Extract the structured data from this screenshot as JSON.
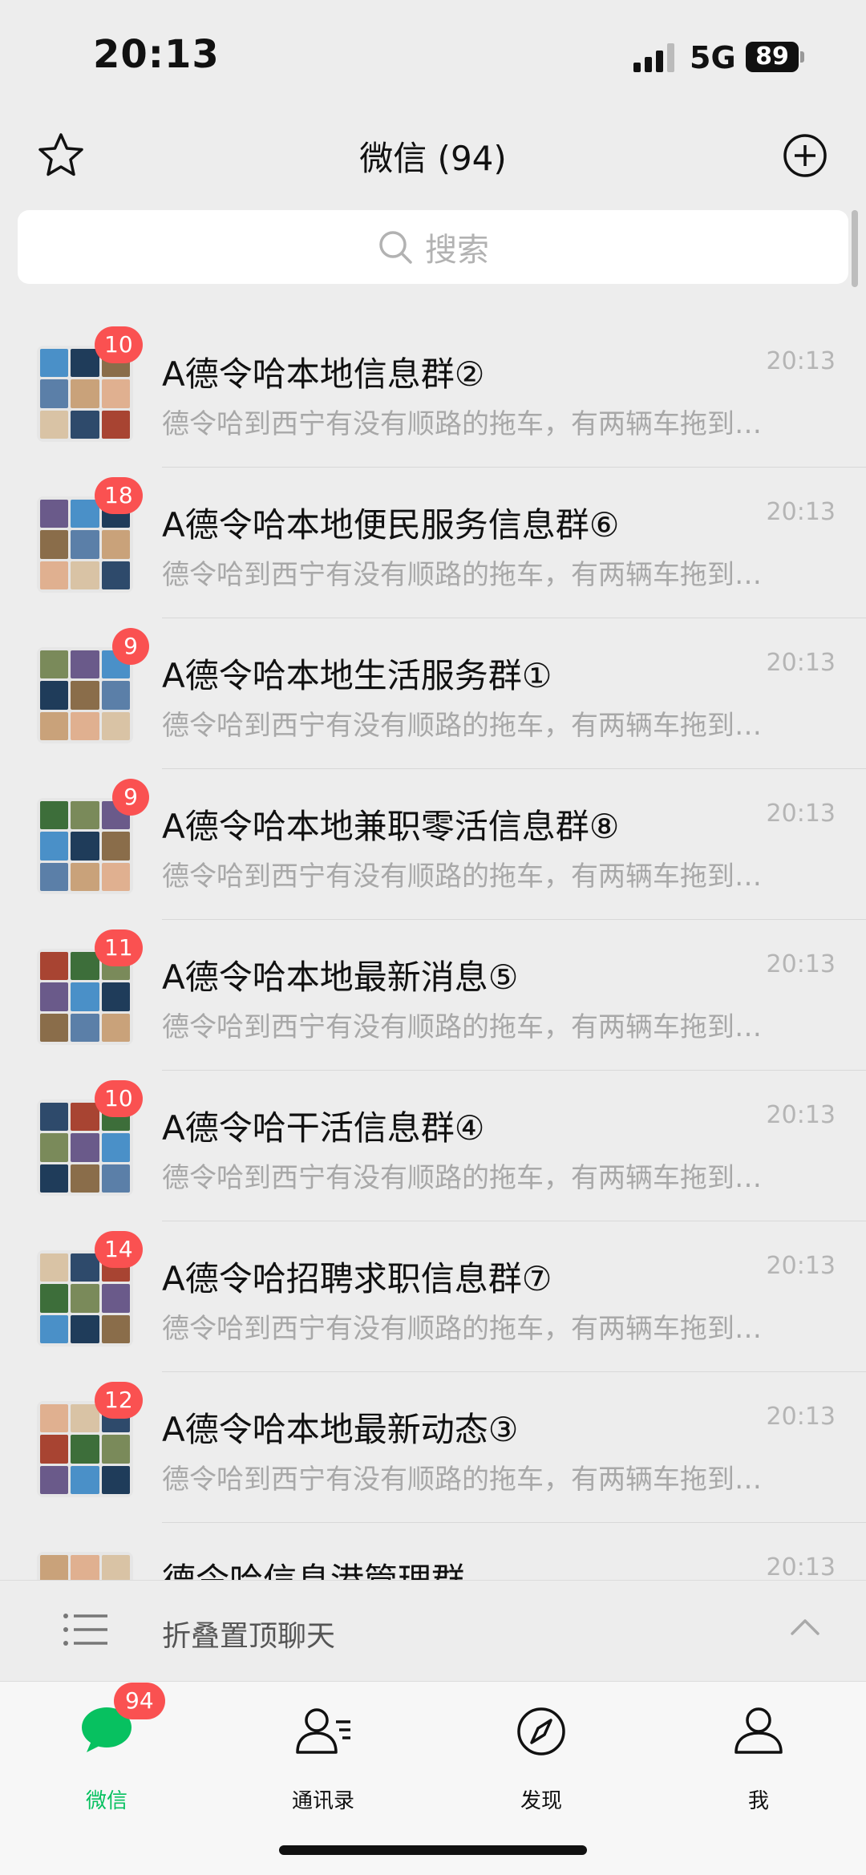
{
  "status": {
    "time": "20:13",
    "network": "5G",
    "battery": "89"
  },
  "header": {
    "title": "微信 (94)"
  },
  "search": {
    "placeholder": "搜索"
  },
  "chats": [
    {
      "name": "A德令哈本地信息群②",
      "time": "20:13",
      "preview": "德令哈到西宁有没有顺路的拖车，有两辆车拖到…",
      "badge": "10"
    },
    {
      "name": "A德令哈本地便民服务信息群⑥",
      "time": "20:13",
      "preview": "德令哈到西宁有没有顺路的拖车，有两辆车拖到…",
      "badge": "18"
    },
    {
      "name": "A德令哈本地生活服务群①",
      "time": "20:13",
      "preview": "德令哈到西宁有没有顺路的拖车，有两辆车拖到…",
      "badge": "9"
    },
    {
      "name": "A德令哈本地兼职零活信息群⑧",
      "time": "20:13",
      "preview": "德令哈到西宁有没有顺路的拖车，有两辆车拖到…",
      "badge": "9"
    },
    {
      "name": "A德令哈本地最新消息⑤",
      "time": "20:13",
      "preview": "德令哈到西宁有没有顺路的拖车，有两辆车拖到…",
      "badge": "11"
    },
    {
      "name": "A德令哈干活信息群④",
      "time": "20:13",
      "preview": "德令哈到西宁有没有顺路的拖车，有两辆车拖到…",
      "badge": "10"
    },
    {
      "name": "A德令哈招聘求职信息群⑦",
      "time": "20:13",
      "preview": "德令哈到西宁有没有顺路的拖车，有两辆车拖到…",
      "badge": "14"
    },
    {
      "name": "A德令哈本地最新动态③",
      "time": "20:13",
      "preview": "德令哈到西宁有没有顺路的拖车，有两辆车拖到…",
      "badge": "12"
    },
    {
      "name": "德令哈信息港管理群",
      "time": "20:13",
      "preview": "",
      "badge": ""
    }
  ],
  "fold": {
    "label": "折叠置顶聊天"
  },
  "tabs": [
    {
      "label": "微信",
      "icon": "chat-bubble-icon",
      "active": true
    },
    {
      "label": "通讯录",
      "icon": "contacts-icon",
      "active": false
    },
    {
      "label": "发现",
      "icon": "compass-icon",
      "active": false
    },
    {
      "label": "我",
      "icon": "person-icon",
      "active": false
    }
  ],
  "tab_badge": "94",
  "colors": {
    "accent": "#07c160",
    "badge": "#fa5151",
    "background": "#ededed"
  }
}
